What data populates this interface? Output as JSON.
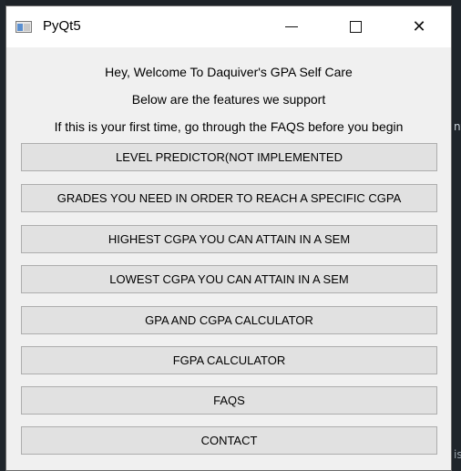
{
  "window": {
    "title": "PyQt5",
    "controls": {
      "minimize": "—",
      "maximize": "☐",
      "close": "✕"
    }
  },
  "intro": {
    "line1": "Hey, Welcome To Daquiver's GPA Self Care",
    "line2": "Below are the features we support",
    "line3": "If this is your first time, go through the FAQS before you begin"
  },
  "buttons": [
    "LEVEL PREDICTOR(NOT IMPLEMENTED",
    "GRADES YOU NEED IN ORDER TO REACH A SPECIFIC CGPA",
    "HIGHEST CGPA YOU CAN ATTAIN IN A SEM",
    "LOWEST CGPA YOU CAN ATTAIN IN A SEM",
    "GPA AND CGPA CALCULATOR",
    "FGPA CALCULATOR",
    "FAQS",
    "CONTACT"
  ],
  "background": {
    "edge_text_1": "nt",
    "edge_text_2": "is"
  }
}
